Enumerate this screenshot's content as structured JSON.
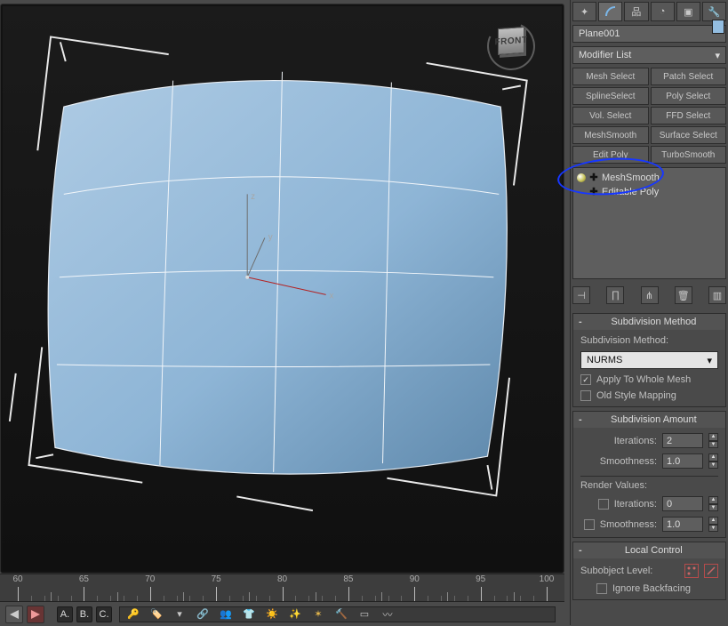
{
  "right_panel": {
    "object_name": "Plane001",
    "modifier_list_label": "Modifier List",
    "presets": [
      "Mesh Select",
      "Patch Select",
      "SplineSelect",
      "Poly Select",
      "Vol. Select",
      "FFD Select",
      "MeshSmooth",
      "Surface Select",
      "Edit Poly",
      "TurboSmooth"
    ],
    "stack": [
      {
        "label": "MeshSmooth",
        "bulb": true
      },
      {
        "label": "Editable Poly",
        "bulb": false
      }
    ]
  },
  "rollouts": {
    "subdiv_method": {
      "title": "Subdivision Method",
      "label": "Subdivision Method:",
      "value": "NURMS",
      "apply_whole_label": "Apply To Whole Mesh",
      "apply_whole_checked": true,
      "old_style_label": "Old Style Mapping",
      "old_style_checked": false
    },
    "subdiv_amount": {
      "title": "Subdivision Amount",
      "iterations_label": "Iterations:",
      "iterations_value": "2",
      "smoothness_label": "Smoothness:",
      "smoothness_value": "1.0",
      "render_values_label": "Render Values:",
      "r_iter_label": "Iterations:",
      "r_iter_value": "0",
      "r_iter_checked": false,
      "r_smooth_label": "Smoothness:",
      "r_smooth_value": "1.0",
      "r_smooth_checked": false
    },
    "local_control": {
      "title": "Local Control",
      "subobject_label": "Subobject Level:",
      "ignore_backfacing_label": "Ignore Backfacing",
      "ignore_backfacing_checked": false
    }
  },
  "viewport": {
    "axis_x": "x",
    "axis_y": "y",
    "axis_z": "z",
    "viewcube_face": "FRONT"
  },
  "timeline": {
    "major_ticks": [
      "60",
      "65",
      "70",
      "75",
      "80",
      "85",
      "90",
      "95",
      "100"
    ],
    "abc_labels": [
      "A.",
      "B.",
      "C."
    ]
  }
}
